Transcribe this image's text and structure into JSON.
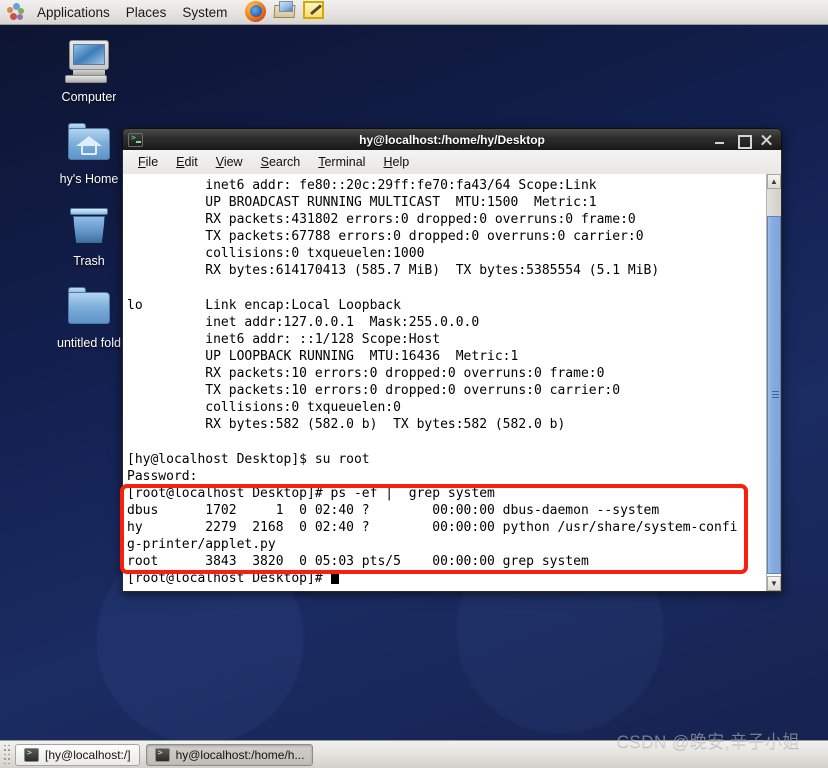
{
  "top_panel": {
    "logo": "gnome-foot-icon",
    "menus": [
      "Applications",
      "Places",
      "System"
    ],
    "launchers": [
      {
        "name": "firefox-icon",
        "title": "Firefox Web Browser"
      },
      {
        "name": "mail-icon",
        "title": "Evolution Mail"
      },
      {
        "name": "text-editor-icon",
        "title": "Text Editor"
      }
    ]
  },
  "desktop": {
    "icons": [
      {
        "label": "Computer",
        "icon": "computer-icon"
      },
      {
        "label": "hy's Home",
        "icon": "home-folder-icon"
      },
      {
        "label": "Trash",
        "icon": "trash-icon"
      },
      {
        "label": "untitled fold",
        "icon": "folder-icon"
      }
    ]
  },
  "terminal": {
    "title": "hy@localhost:/home/hy/Desktop",
    "menus": [
      "File",
      "Edit",
      "View",
      "Search",
      "Terminal",
      "Help"
    ],
    "window_buttons": [
      "minimize-button",
      "maximize-button",
      "close-button"
    ],
    "content": "          inet6 addr: fe80::20c:29ff:fe70:fa43/64 Scope:Link\n          UP BROADCAST RUNNING MULTICAST  MTU:1500  Metric:1\n          RX packets:431802 errors:0 dropped:0 overruns:0 frame:0\n          TX packets:67788 errors:0 dropped:0 overruns:0 carrier:0\n          collisions:0 txqueuelen:1000\n          RX bytes:614170413 (585.7 MiB)  TX bytes:5385554 (5.1 MiB)\n\nlo        Link encap:Local Loopback\n          inet addr:127.0.0.1  Mask:255.0.0.0\n          inet6 addr: ::1/128 Scope:Host\n          UP LOOPBACK RUNNING  MTU:16436  Metric:1\n          RX packets:10 errors:0 dropped:0 overruns:0 frame:0\n          TX packets:10 errors:0 dropped:0 overruns:0 carrier:0\n          collisions:0 txqueuelen:0\n          RX bytes:582 (582.0 b)  TX bytes:582 (582.0 b)\n\n[hy@localhost Desktop]$ su root\nPassword:\n[root@localhost Desktop]# ps -ef |  grep system\ndbus      1702     1  0 02:40 ?        00:00:00 dbus-daemon --system\nhy        2279  2168  0 02:40 ?        00:00:00 python /usr/share/system-confi\ng-printer/applet.py\nroot      3843  3820  0 05:03 pts/5    00:00:00 grep system\n",
    "last_prompt": "[root@localhost Desktop]# ",
    "scrollbar": {
      "up_arrow": "▲",
      "down_arrow": "▼"
    }
  },
  "annotation": {
    "color": "#f81f0c",
    "name": "red-highlight-box"
  },
  "bottom_panel": {
    "tasks": [
      {
        "label": "[hy@localhost:/]",
        "active": false
      },
      {
        "label": "hy@localhost:/home/h...",
        "active": true
      }
    ],
    "watermark": "CSDN @晚安,辛子小姐"
  }
}
